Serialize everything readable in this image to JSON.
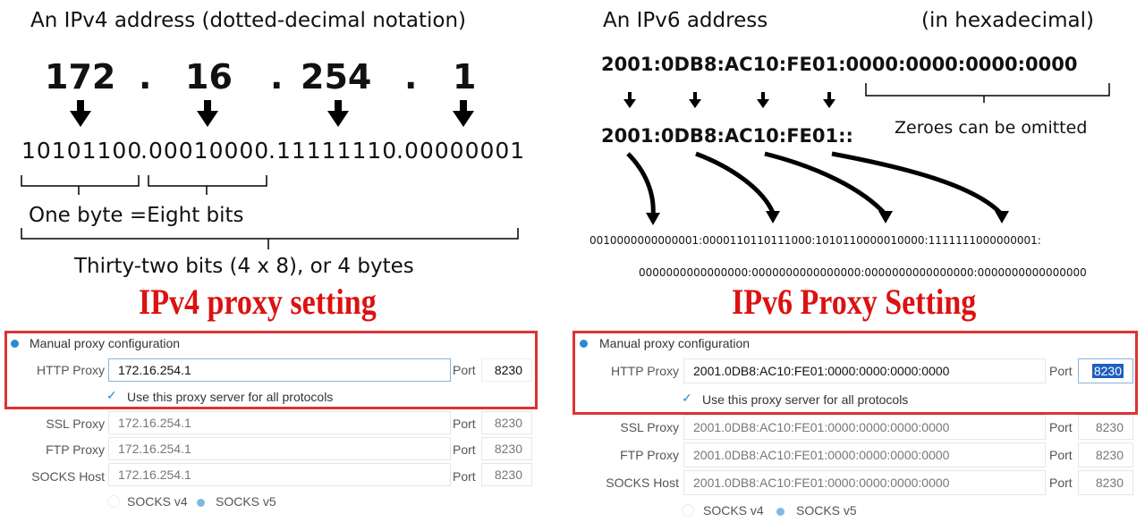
{
  "ipv4": {
    "heading": "An IPv4 address  (dotted-decimal notation)",
    "octets": [
      "172",
      "16",
      "254",
      "1"
    ],
    "dot": ".",
    "binary": [
      "10101100",
      ".00010000",
      ".11111110",
      ".00000001"
    ],
    "byte_label": "One byte =Eight bits",
    "total_label": "Thirty-two bits (4 x 8), or 4 bytes",
    "title": "IPv4 proxy setting"
  },
  "ipv6": {
    "heading": "An IPv6 address",
    "heading_note": "(in hexadecimal)",
    "full": "2001:0DB8:AC10:FE01:0000:0000:0000:0000",
    "short": "2001:0DB8:AC10:FE01::",
    "omit_label": "Zeroes can be omitted",
    "binary_line1": "0010000000000001:0000110110111000:1010110000010000:1111111000000001:",
    "binary_line2": "0000000000000000:0000000000000000:0000000000000000:0000000000000000",
    "title": "IPv6 Proxy Setting"
  },
  "proxy_v4": {
    "manual": "Manual proxy configuration",
    "rows": [
      {
        "label": "HTTP Proxy",
        "value": "172.16.254.1",
        "port_label": "Port",
        "port": "8230"
      },
      {
        "label": "SSL Proxy",
        "value": "172.16.254.1",
        "port_label": "Port",
        "port": "8230"
      },
      {
        "label": "FTP Proxy",
        "value": "172.16.254.1",
        "port_label": "Port",
        "port": "8230"
      },
      {
        "label": "SOCKS Host",
        "value": "172.16.254.1",
        "port_label": "Port",
        "port": "8230"
      }
    ],
    "use_all": "Use this proxy server for all protocols",
    "socks4": "SOCKS v4",
    "socks5": "SOCKS v5"
  },
  "proxy_v6": {
    "manual": "Manual proxy configuration",
    "rows": [
      {
        "label": "HTTP Proxy",
        "value": "2001.0DB8:AC10:FE01:0000:0000:0000:0000",
        "port_label": "Port",
        "port": "8230"
      },
      {
        "label": "SSL Proxy",
        "value": "2001.0DB8:AC10:FE01:0000:0000:0000:0000",
        "port_label": "Port",
        "port": "8230"
      },
      {
        "label": "FTP Proxy",
        "value": "2001.0DB8:AC10:FE01:0000:0000:0000:0000",
        "port_label": "Port",
        "port": "8230"
      },
      {
        "label": "SOCKS Host",
        "value": "2001.0DB8:AC10:FE01:0000:0000:0000:0000",
        "port_label": "Port",
        "port": "8230"
      }
    ],
    "use_all": "Use this proxy server for all protocols",
    "socks4": "SOCKS v4",
    "socks5": "SOCKS v5"
  },
  "colors": {
    "accent": "#d11111",
    "radio": "#2a8bd0"
  }
}
